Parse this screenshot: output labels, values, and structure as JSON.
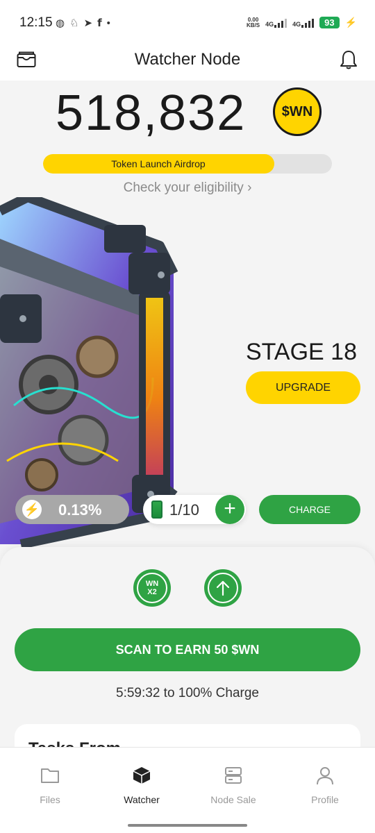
{
  "status_bar": {
    "time": "12:15",
    "net_speed_value": "0.00",
    "net_speed_unit": "KB/S",
    "sig1": "4G",
    "sig2": "4G",
    "battery": "93"
  },
  "header": {
    "title": "Watcher Node"
  },
  "balance": {
    "amount": "518,832",
    "token": "$WN"
  },
  "airdrop": {
    "label": "Token Launch Airdrop",
    "progress": 0.8,
    "link": "Check your eligibility"
  },
  "node": {
    "stage": "STAGE 18",
    "upgrade_label": "UPGRADE"
  },
  "stats": {
    "rate": "0.13%",
    "batteries": "1/10",
    "charge_label": "CHARGE"
  },
  "boosts": {
    "multiplier_line1": "WN",
    "multiplier_line2": "X2"
  },
  "scan": {
    "label": "SCAN TO EARN 50 $WN",
    "timer": "5:59:32 to 100% Charge"
  },
  "tasks": {
    "title": "Tasks From"
  },
  "nav": {
    "items": [
      {
        "label": "Files"
      },
      {
        "label": "Watcher"
      },
      {
        "label": "Node Sale"
      },
      {
        "label": "Profile"
      }
    ]
  },
  "colors": {
    "accent_yellow": "#ffd400",
    "accent_green": "#2fa344"
  }
}
